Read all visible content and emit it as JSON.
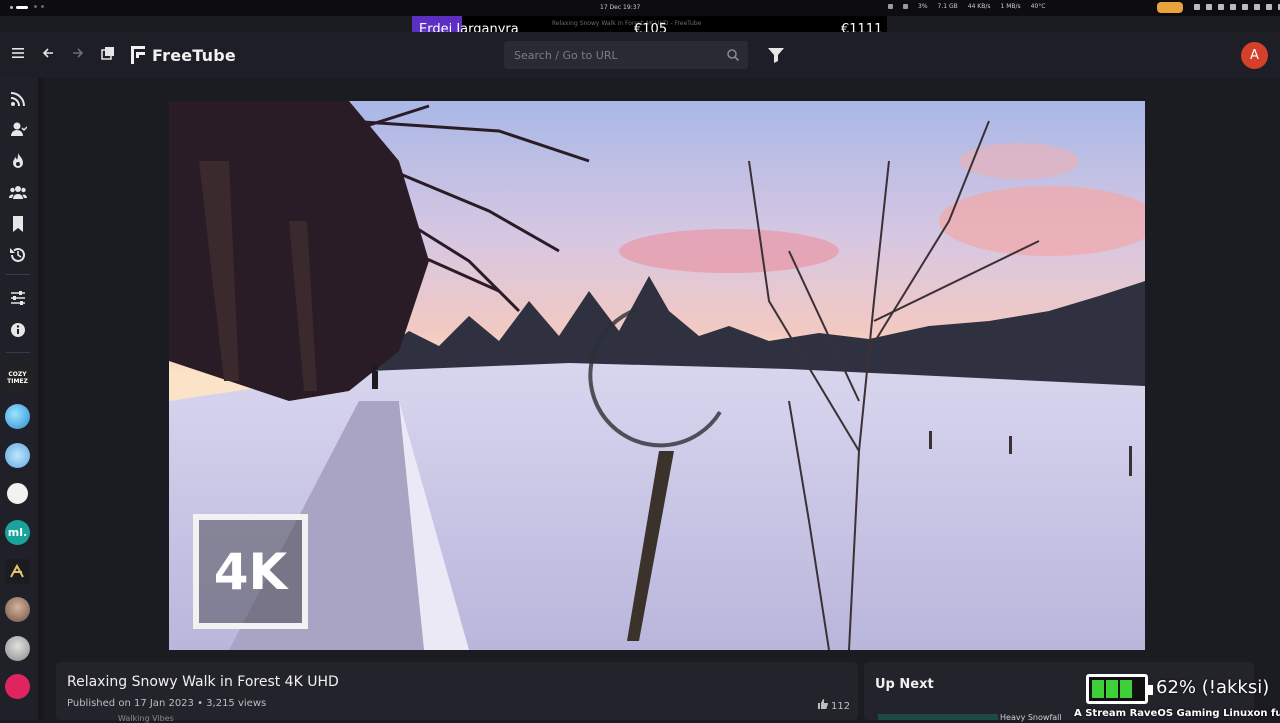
{
  "system_bar": {
    "clock": "17 Dec 19:37",
    "cpu": "3%",
    "memory": "7.1 GB",
    "net_down": "44 KB/s",
    "net_up": "1 MB/s",
    "temp": "40°C"
  },
  "ticker": {
    "name": "Erdei Jarganyra",
    "amount_1": "€105",
    "amount_2": "€1111",
    "ghost_title": "Relaxing Snowy Walk in Forest 4K UHD - FreeTube",
    "colors": {
      "name_bg": "#5d2ec2"
    }
  },
  "header": {
    "app_name": "FreeTube",
    "search_placeholder": "Search / Go to URL",
    "avatar_letter": "A",
    "icons": [
      "menu-icon",
      "back-arrow-icon",
      "forward-arrow-icon",
      "new-window-icon",
      "search-icon",
      "filter-icon"
    ],
    "colors": {
      "avatar": "#d5402b"
    }
  },
  "sidebar": {
    "items": [
      {
        "name": "subscriptions",
        "icon": "rss-icon"
      },
      {
        "name": "channels",
        "icon": "user-icon"
      },
      {
        "name": "trending",
        "icon": "fire-icon"
      },
      {
        "name": "popular",
        "icon": "users-icon"
      },
      {
        "name": "saved",
        "icon": "bookmark-icon"
      },
      {
        "name": "history",
        "icon": "history-icon"
      },
      {
        "name": "settings",
        "icon": "sliders-icon"
      },
      {
        "name": "about",
        "icon": "info-icon"
      }
    ],
    "channels": [
      {
        "name": "cozy-times",
        "text": "COZY TIMEZ"
      },
      {
        "name": "channel-2",
        "text": ""
      },
      {
        "name": "channel-3",
        "text": ""
      },
      {
        "name": "channel-4",
        "text": ""
      },
      {
        "name": "channel-ml",
        "text": "ml."
      },
      {
        "name": "channel-6",
        "text": ""
      },
      {
        "name": "channel-7",
        "text": ""
      },
      {
        "name": "channel-8",
        "text": ""
      },
      {
        "name": "channel-9",
        "text": ""
      }
    ]
  },
  "video": {
    "badge": "4K",
    "loading": true
  },
  "info": {
    "title": "Relaxing Snowy Walk in Forest 4K UHD",
    "meta": "Published on 17 Jan 2023 • 3,215 views",
    "likes": "112",
    "channel_partial": "Walking Vibes"
  },
  "up_next": {
    "heading": "Up Next",
    "next_title_partial": "Heavy Snowfall"
  },
  "overlay": {
    "battery_percent": 62,
    "battery_text": "62% (!akksi)",
    "stream_text": "A Stream RaveOS Gaming Linuxon fut",
    "colors": {
      "battery_fill": "#3ecf3a"
    }
  }
}
